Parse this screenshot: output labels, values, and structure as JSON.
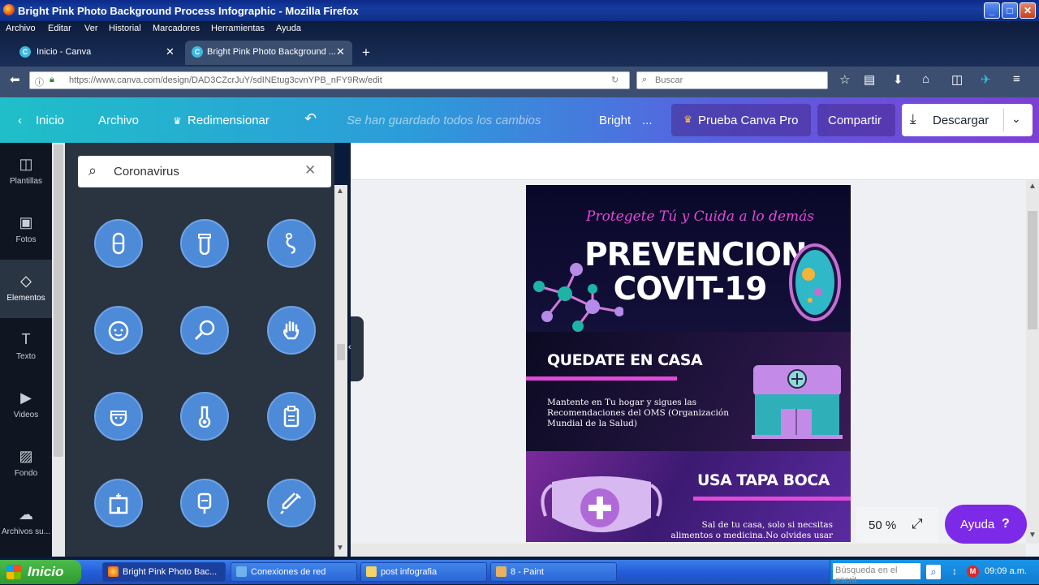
{
  "window": {
    "title": "Bright Pink Photo Background Process Infographic - Mozilla Firefox",
    "min": "_",
    "max": "□",
    "close": "✕"
  },
  "menu": [
    "Archivo",
    "Editar",
    "Ver",
    "Historial",
    "Marcadores",
    "Herramientas",
    "Ayuda"
  ],
  "tabs": [
    {
      "label": "Inicio - Canva",
      "favicon": "C",
      "close": "✕"
    },
    {
      "label": "Bright Pink Photo Background ...",
      "favicon": "C",
      "close": "✕"
    }
  ],
  "new_tab": "+",
  "url": "https://www.canva.com/design/DAD3CZcrJuY/sdINEtug3cvnYPB_nFY9Rw/edit",
  "search_placeholder": "Buscar",
  "canva_header": {
    "home": "Inicio",
    "file": "Archivo",
    "resize": "Redimensionar",
    "saved": "Se han guardado todos los cambios",
    "title": "Bright",
    "more": "...",
    "pro": "Prueba Canva Pro",
    "share": "Compartir",
    "download": "Descargar"
  },
  "rail": [
    {
      "label": "Plantillas",
      "icon": "template-icon"
    },
    {
      "label": "Fotos",
      "icon": "photo-icon"
    },
    {
      "label": "Elementos",
      "icon": "elements-icon"
    },
    {
      "label": "Texto",
      "icon": "text-icon"
    },
    {
      "label": "Videos",
      "icon": "video-icon"
    },
    {
      "label": "Fondo",
      "icon": "background-icon"
    },
    {
      "label": "Archivos su...",
      "icon": "upload-icon"
    }
  ],
  "panel": {
    "search_value": "Coronavirus",
    "elements": [
      "pill-icon",
      "test-tube-icon",
      "pregnant-icon",
      "baby-icon",
      "magnifier-icon",
      "hand-icon",
      "nurse-icon",
      "thermometer-icon",
      "clipboard-icon",
      "hospital-icon",
      "iv-bag-icon",
      "syringe-icon"
    ]
  },
  "design": {
    "tagline": "Protegete Tú y Cuida a lo demás",
    "title1": "PREVENCION",
    "title2": "COVIT-19",
    "h1": "QUEDATE EN CASA",
    "b1": "Mantente en Tu hogar y sigues las Recomendaciones del OMS (Organización Mundial de la Salud)",
    "h2": "USA TAPA BOCA",
    "b2": "Sal de tu casa, solo si necsitas alimentos o medicina.No olvides usar tu tapa boca"
  },
  "zoom": "50 %",
  "help": "Ayuda",
  "help_q": "?",
  "taskbar": {
    "start": "Inicio",
    "tasks": [
      "Bright Pink Photo Bac...",
      "Conexiones de red",
      "post infografia",
      "8 - Paint"
    ],
    "search": "Búsqueda en el escrit",
    "clock": "09:09 a.m."
  },
  "colors": {
    "accent": "#7d2ae8",
    "pink": "#e14ad8",
    "teal": "#1fbfc9"
  }
}
